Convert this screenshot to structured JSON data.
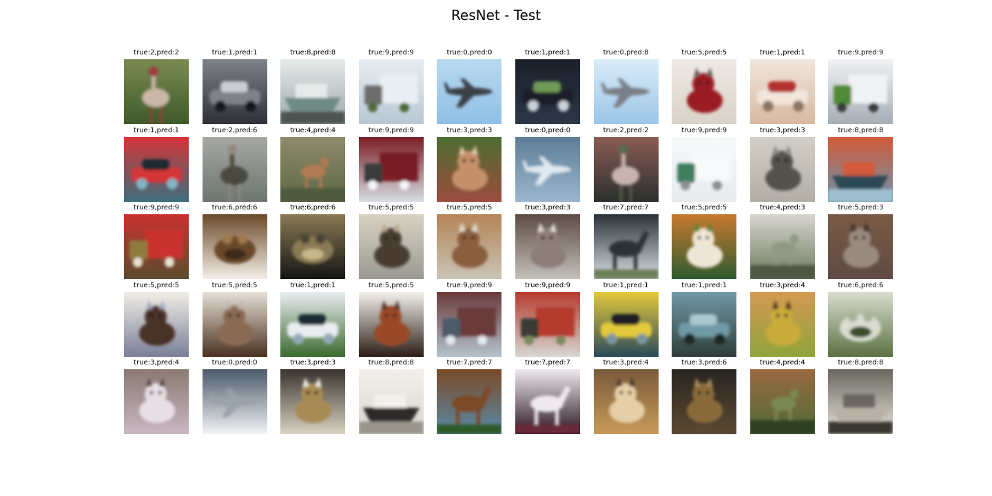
{
  "figure": {
    "title": "ResNet - Test"
  },
  "samples": [
    {
      "caption": "true:2,pred:2",
      "subject": "ostrich",
      "palette": [
        "#3f5a2a",
        "#7a8b52",
        "#c9b7a8",
        "#a23a3a"
      ]
    },
    {
      "caption": "true:1,pred:1",
      "subject": "car",
      "palette": [
        "#2f3136",
        "#7e8289",
        "#c9ccd1",
        "#15161a"
      ]
    },
    {
      "caption": "true:8,pred:8",
      "subject": "ship",
      "palette": [
        "#9aa7a8",
        "#e6ebea",
        "#6f8a86",
        "#4d5552"
      ]
    },
    {
      "caption": "true:9,pred:9",
      "subject": "truck",
      "palette": [
        "#b8c7d4",
        "#e9eef2",
        "#6d6d6d",
        "#4f6a3d"
      ]
    },
    {
      "caption": "true:0,pred:0",
      "subject": "airplane",
      "palette": [
        "#8fc0e6",
        "#b9d9f0",
        "#3b3f47",
        "#a7c9e6"
      ]
    },
    {
      "caption": "true:1,pred:1",
      "subject": "car",
      "palette": [
        "#2c3747",
        "#1b1f2a",
        "#6d9a54",
        "#c9d0d6"
      ]
    },
    {
      "caption": "true:0,pred:8",
      "subject": "airplane",
      "palette": [
        "#9cc6e8",
        "#d9ecf8",
        "#7a8088",
        "#4c5b6a"
      ]
    },
    {
      "caption": "true:5,pred:5",
      "subject": "dog",
      "palette": [
        "#d8d2c8",
        "#efeae3",
        "#9a1f22",
        "#6b6158"
      ]
    },
    {
      "caption": "true:1,pred:1",
      "subject": "car",
      "palette": [
        "#d7b9a0",
        "#f1e5dc",
        "#b3312f",
        "#8c7464"
      ]
    },
    {
      "caption": "true:9,pred:9",
      "subject": "truck",
      "palette": [
        "#a6aeb6",
        "#f0f2f4",
        "#4f8a38",
        "#3a3a3a"
      ]
    },
    {
      "caption": "true:1,pred:1",
      "subject": "car",
      "palette": [
        "#3d6e7c",
        "#d43437",
        "#1c2b31",
        "#7fb6c4"
      ]
    },
    {
      "caption": "true:2,pred:6",
      "subject": "bird",
      "palette": [
        "#6e7570",
        "#a6a8a4",
        "#4c4a3e",
        "#8f8a7d"
      ]
    },
    {
      "caption": "true:4,pred:4",
      "subject": "deer",
      "palette": [
        "#5d6845",
        "#8e8a6a",
        "#b07a52",
        "#4d5a3c"
      ]
    },
    {
      "caption": "true:9,pred:9",
      "subject": "truck",
      "palette": [
        "#d6dde3",
        "#7a1f25",
        "#3b3b3b",
        "#f3f5f7"
      ]
    },
    {
      "caption": "true:3,pred:3",
      "subject": "cat",
      "palette": [
        "#9c4b3e",
        "#4d6d32",
        "#c58f6b",
        "#e2c6a9"
      ]
    },
    {
      "caption": "true:0,pred:0",
      "subject": "airplane",
      "palette": [
        "#9ab7cf",
        "#5f7d96",
        "#dfe8ef",
        "#3f5568"
      ]
    },
    {
      "caption": "true:2,pred:2",
      "subject": "ostrich",
      "palette": [
        "#2b2f2d",
        "#8b5c55",
        "#c9b3ad",
        "#5a6b4f"
      ]
    },
    {
      "caption": "true:9,pred:9",
      "subject": "truck",
      "palette": [
        "#e7ebee",
        "#f7f9fa",
        "#3e7f5e",
        "#8d8f93"
      ]
    },
    {
      "caption": "true:3,pred:3",
      "subject": "cat",
      "palette": [
        "#b2aea6",
        "#d3cfc7",
        "#55514b",
        "#8c8880"
      ]
    },
    {
      "caption": "true:8,pred:8",
      "subject": "ship",
      "palette": [
        "#6b95ab",
        "#d25a3a",
        "#2f4a57",
        "#9fc1d2"
      ]
    },
    {
      "caption": "true:9,pred:9",
      "subject": "truck",
      "palette": [
        "#5a4d2d",
        "#c9312f",
        "#8f7a3d",
        "#e8e2d0"
      ]
    },
    {
      "caption": "true:6,pred:6",
      "subject": "frog",
      "palette": [
        "#f3efe8",
        "#6b4a2a",
        "#3c2a1a",
        "#a0784d"
      ]
    },
    {
      "caption": "true:6,pred:6",
      "subject": "frog",
      "palette": [
        "#141412",
        "#8a7a55",
        "#c6b889",
        "#4a4534"
      ]
    },
    {
      "caption": "true:5,pred:5",
      "subject": "dog",
      "palette": [
        "#9a9a92",
        "#d9d2c4",
        "#4a3c30",
        "#bba88f"
      ]
    },
    {
      "caption": "true:5,pred:5",
      "subject": "dog",
      "palette": [
        "#c9c4b8",
        "#b48456",
        "#8a5f3c",
        "#e4dfd5"
      ]
    },
    {
      "caption": "true:3,pred:3",
      "subject": "cat",
      "palette": [
        "#c4c0bb",
        "#5d4b44",
        "#8d7e78",
        "#e3e0dc"
      ]
    },
    {
      "caption": "true:7,pred:7",
      "subject": "horse",
      "palette": [
        "#d9dee3",
        "#2a3138",
        "#6d7f5a",
        "#a9b4bb"
      ]
    },
    {
      "caption": "true:5,pred:5",
      "subject": "dog",
      "palette": [
        "#2f5b2f",
        "#c8792f",
        "#f0e6d6",
        "#5a8a3d"
      ]
    },
    {
      "caption": "true:4,pred:3",
      "subject": "deer",
      "palette": [
        "#6a7a5e",
        "#d8d5cf",
        "#8f9a84",
        "#4b5842"
      ]
    },
    {
      "caption": "true:5,pred:3",
      "subject": "dog",
      "palette": [
        "#5e4b45",
        "#7a5a44",
        "#9a8a80",
        "#3f302b"
      ]
    },
    {
      "caption": "true:5,pred:5",
      "subject": "dog",
      "palette": [
        "#7a7f98",
        "#f1ede6",
        "#4a3028",
        "#a3a8bd"
      ]
    },
    {
      "caption": "true:5,pred:5",
      "subject": "dog",
      "palette": [
        "#4a3020",
        "#e6e0d6",
        "#8a6a52",
        "#bdb3a6"
      ]
    },
    {
      "caption": "true:1,pred:1",
      "subject": "car",
      "palette": [
        "#3b6a2e",
        "#e9edf1",
        "#1f2a35",
        "#93a8b8"
      ]
    },
    {
      "caption": "true:5,pred:5",
      "subject": "dog",
      "palette": [
        "#2c1d16",
        "#f4f1ec",
        "#9a4a25",
        "#5a3a2a"
      ]
    },
    {
      "caption": "true:9,pred:9",
      "subject": "truck",
      "palette": [
        "#b4c3cf",
        "#6a3a3a",
        "#4d5a68",
        "#e2e8ee"
      ]
    },
    {
      "caption": "true:9,pred:9",
      "subject": "truck",
      "palette": [
        "#d6d8d2",
        "#b53a2e",
        "#3a3a35",
        "#7a8a5f"
      ]
    },
    {
      "caption": "true:1,pred:1",
      "subject": "car",
      "palette": [
        "#2b4a5a",
        "#e3c93a",
        "#1a1f22",
        "#7b96a0"
      ]
    },
    {
      "caption": "true:1,pred:1",
      "subject": "car",
      "palette": [
        "#2f3d3a",
        "#6f9aa6",
        "#a9c7cf",
        "#1d2524"
      ]
    },
    {
      "caption": "true:3,pred:4",
      "subject": "cat",
      "palette": [
        "#8fa43a",
        "#d49a52",
        "#c9ac3a",
        "#5a3a22"
      ]
    },
    {
      "caption": "true:6,pred:6",
      "subject": "frog",
      "palette": [
        "#5a7242",
        "#d9dccf",
        "#3a4d2c",
        "#a8b49a"
      ]
    },
    {
      "caption": "true:3,pred:4",
      "subject": "cat",
      "palette": [
        "#c9b7c3",
        "#8a7a72",
        "#e8dfe5",
        "#5a4d48"
      ]
    },
    {
      "caption": "true:0,pred:0",
      "subject": "airplane",
      "palette": [
        "#f2f3f5",
        "#4c5a6a",
        "#9aa3ad",
        "#c6b17a"
      ]
    },
    {
      "caption": "true:3,pred:3",
      "subject": "cat",
      "palette": [
        "#d9d2c2",
        "#3a342e",
        "#a88a52",
        "#f2ece2"
      ]
    },
    {
      "caption": "true:8,pred:8",
      "subject": "ship",
      "palette": [
        "#d9d6cf",
        "#f2f0ea",
        "#2e2c2a",
        "#9a958c"
      ]
    },
    {
      "caption": "true:7,pred:7",
      "subject": "horse",
      "palette": [
        "#5a8aa8",
        "#7a4a28",
        "#2f5a2a",
        "#e6e9eb"
      ]
    },
    {
      "caption": "true:7,pred:7",
      "subject": "horse",
      "palette": [
        "#2a1620",
        "#efe9ef",
        "#6a2a3a",
        "#8a6a7a"
      ]
    },
    {
      "caption": "true:3,pred:4",
      "subject": "cat",
      "palette": [
        "#c89a5a",
        "#7a5a3a",
        "#e6cfa8",
        "#4a3a2a"
      ]
    },
    {
      "caption": "true:3,pred:6",
      "subject": "cat",
      "palette": [
        "#5a4a32",
        "#2a2420",
        "#8a6a3a",
        "#a58a5a"
      ]
    },
    {
      "caption": "true:4,pred:4",
      "subject": "deer",
      "palette": [
        "#4f6a36",
        "#9a6a42",
        "#7a8a52",
        "#2f3f22"
      ]
    },
    {
      "caption": "true:8,pred:8",
      "subject": "ship",
      "palette": [
        "#e9e6de",
        "#6a665e",
        "#b8b2a6",
        "#3a3832"
      ]
    }
  ]
}
